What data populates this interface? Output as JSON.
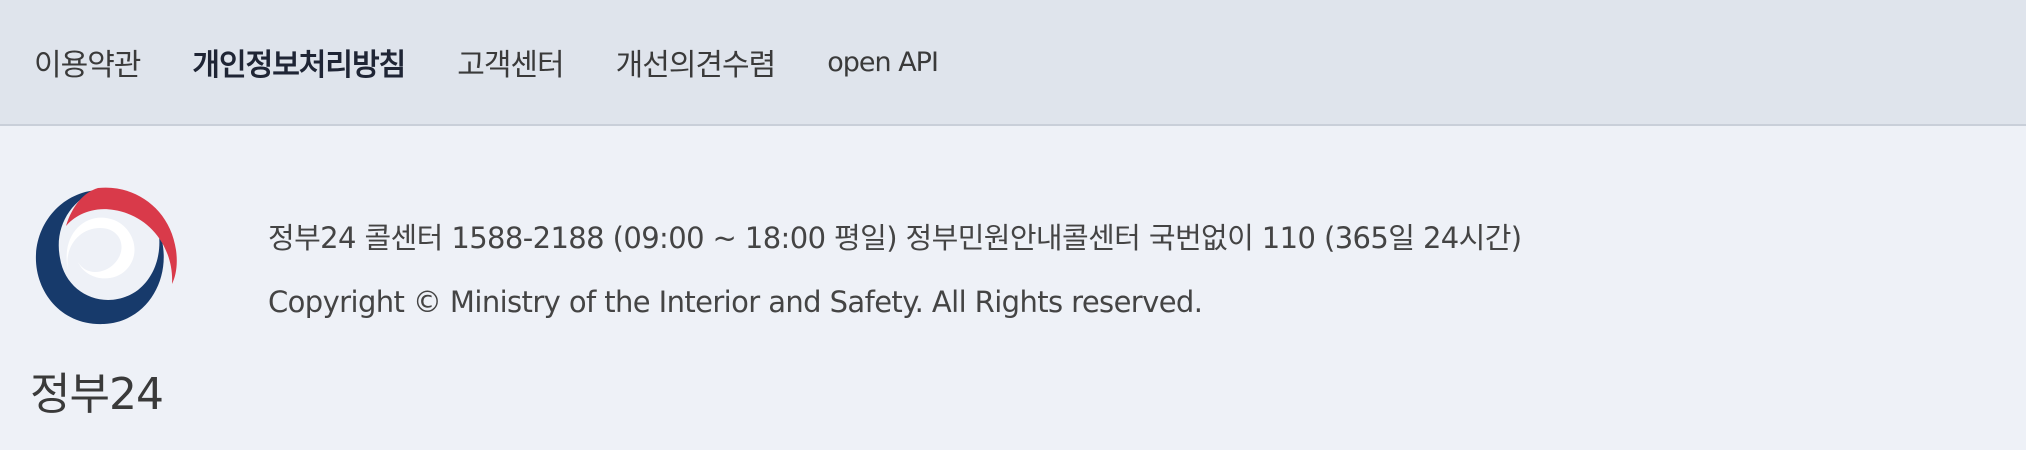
{
  "nav": {
    "items": [
      {
        "label": "이용약관"
      },
      {
        "label": "개인정보처리방침"
      },
      {
        "label": "고객센터"
      },
      {
        "label": "개선의견수렴"
      },
      {
        "label": "open API"
      }
    ]
  },
  "footer": {
    "logo_text": "정부24",
    "contact": "정부24 콜센터 1588-2188 (09:00 ~ 18:00 평일) 정부민원안내콜센터 국번없이 110 (365일 24시간)",
    "copyright": "Copyright © Ministry of the Interior and Safety. All Rights reserved."
  },
  "colors": {
    "emblem_red": "#d93a4a",
    "emblem_blue": "#173a6b"
  },
  "icons": {
    "logo": "korea-government-emblem-icon"
  }
}
